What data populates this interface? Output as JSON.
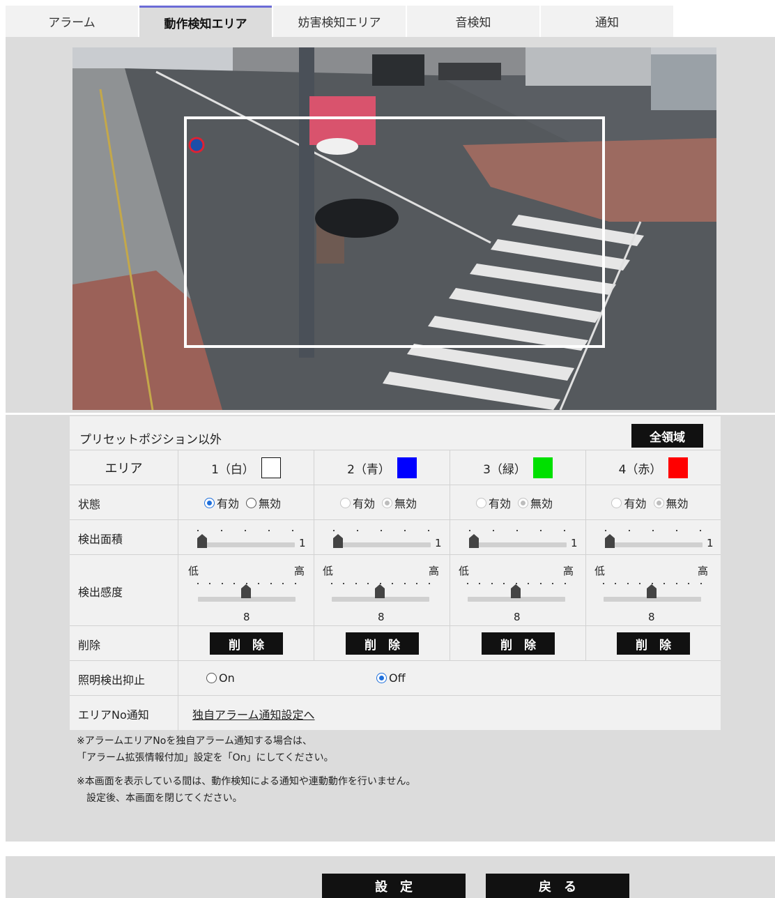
{
  "tabs": [
    {
      "label": "アラーム",
      "active": false
    },
    {
      "label": "動作検知エリア",
      "active": true
    },
    {
      "label": "妨害検知エリア",
      "active": false
    },
    {
      "label": "音検知",
      "active": false
    },
    {
      "label": "通知",
      "active": false
    }
  ],
  "preset_label": "プリセットポジション以外",
  "full_area_button": "全領域",
  "rows": {
    "area": "エリア",
    "status": "状態",
    "detection_area": "検出面積",
    "sensitivity": "検出感度",
    "delete": "削除",
    "light_suppression": "照明検出抑止",
    "area_no_notify": "エリアNo通知"
  },
  "areas": [
    {
      "label": "1（白）",
      "color": "#ffffff",
      "status": "有効",
      "enabled_controls": true,
      "area_value": "1",
      "sensitivity": "8"
    },
    {
      "label": "2（青）",
      "color": "#0000ff",
      "status": "無効",
      "enabled_controls": false,
      "area_value": "1",
      "sensitivity": "8"
    },
    {
      "label": "3（緑）",
      "color": "#00e000",
      "status": "無効",
      "enabled_controls": false,
      "area_value": "1",
      "sensitivity": "8"
    },
    {
      "label": "4（赤）",
      "color": "#ff0000",
      "status": "無効",
      "enabled_controls": false,
      "area_value": "1",
      "sensitivity": "8"
    }
  ],
  "status_options": {
    "on": "有効",
    "off": "無効"
  },
  "sensitivity_labels": {
    "low": "低",
    "high": "高"
  },
  "delete_label": "削　除",
  "light_suppression": {
    "on": "On",
    "off": "Off",
    "selected": "Off"
  },
  "area_no_link": "独自アラーム通知設定へ",
  "notes": [
    "※アラームエリアNoを独自アラーム通知する場合は、",
    "「アラーム拡張情報付加」設定を「On」にしてください。",
    "※本画面を表示している間は、動作検知による通知や連動動作を行いません。",
    "　設定後、本画面を閉じてください。"
  ],
  "buttons": {
    "set": "設　定",
    "back": "戻　る"
  }
}
